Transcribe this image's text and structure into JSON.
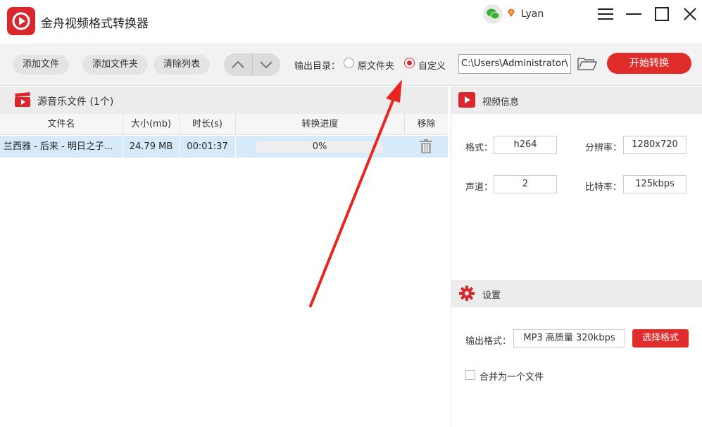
{
  "app": {
    "title": "金舟视频格式转换器",
    "username": "Lyan"
  },
  "toolbar": {
    "add_file": "添加文件",
    "add_folder": "添加文件夹",
    "clear_list": "清除列表",
    "output_dir_label": "输出目录：",
    "radio_original": "原文件夹",
    "radio_custom": "自定义",
    "custom_selected": true,
    "path_value": "C:\\Users\\Administrator\\",
    "start_label": "开始转换"
  },
  "file_list": {
    "title": "源音乐文件 (1个)",
    "columns": [
      "文件名",
      "大小(mb)",
      "时长(s)",
      "转换进度",
      "移除"
    ],
    "rows": [
      {
        "name": "兰西雅 - 后来 - 明日之子...",
        "size": "24.79 MB",
        "duration": "00:01:37",
        "progress_text": "0%",
        "progress": 0
      }
    ]
  },
  "video_info": {
    "title": "视频信息",
    "format_label": "格式：",
    "format_value": "h264",
    "resolution_label": "分辨率：",
    "resolution_value": "1280x720",
    "channel_label": "声道：",
    "channel_value": "2",
    "bitrate_label": "比特率：",
    "bitrate_value": "125kbps"
  },
  "settings": {
    "title": "设置",
    "output_format_label": "输出格式：",
    "output_format_value": "MP3 高质量 320kbps",
    "select_format_label": "选择格式",
    "merge_label": "合并为一个文件",
    "merge_checked": false
  },
  "colors": {
    "accent": "#e12c2c",
    "row_selected": "#d6eaf9",
    "toolbar_bg": "#f2f2f2"
  }
}
